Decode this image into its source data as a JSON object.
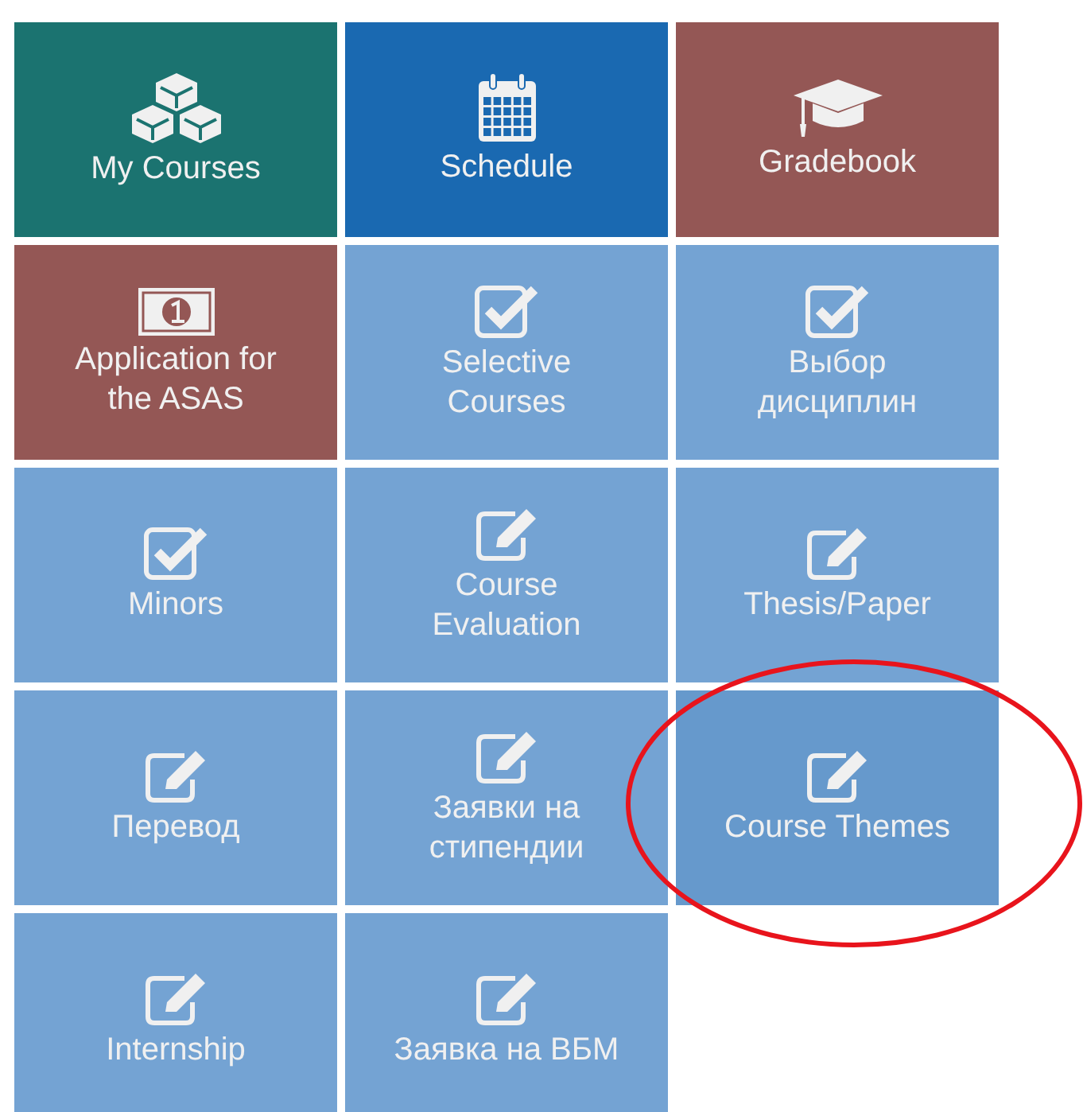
{
  "tiles": [
    {
      "lines": [
        "My Courses"
      ],
      "kind": "cubes",
      "color": "#1b7370",
      "highlighted": false
    },
    {
      "lines": [
        "Schedule"
      ],
      "kind": "calendar",
      "color": "#1a69b1",
      "highlighted": false
    },
    {
      "lines": [
        "Gradebook"
      ],
      "kind": "cap",
      "color": "#945755",
      "highlighted": false
    },
    {
      "lines": [
        "Application for",
        "the ASAS"
      ],
      "kind": "money",
      "color": "#945755",
      "highlighted": false
    },
    {
      "lines": [
        "Selective",
        "Courses"
      ],
      "kind": "check",
      "color": "#74a3d3",
      "highlighted": false
    },
    {
      "lines": [
        "Выбор",
        "дисциплин"
      ],
      "kind": "check",
      "color": "#74a3d3",
      "highlighted": false
    },
    {
      "lines": [
        "Minors"
      ],
      "kind": "check",
      "color": "#74a3d3",
      "highlighted": false
    },
    {
      "lines": [
        "Course",
        "Evaluation"
      ],
      "kind": "edit",
      "color": "#74a3d3",
      "highlighted": false
    },
    {
      "lines": [
        "Thesis/Paper"
      ],
      "kind": "edit",
      "color": "#74a3d3",
      "highlighted": false
    },
    {
      "lines": [
        "Перевод"
      ],
      "kind": "edit",
      "color": "#74a3d3",
      "highlighted": false
    },
    {
      "lines": [
        "Заявки на",
        "стипендии"
      ],
      "kind": "edit",
      "color": "#74a3d3",
      "highlighted": false
    },
    {
      "lines": [
        "Course Themes"
      ],
      "kind": "edit",
      "color": "#6699cc",
      "highlighted": true
    },
    {
      "lines": [
        "Internship"
      ],
      "kind": "edit",
      "color": "#74a3d3",
      "highlighted": false
    },
    {
      "lines": [
        "Заявка на ВБМ"
      ],
      "kind": "edit",
      "color": "#74a3d3",
      "highlighted": false
    }
  ]
}
